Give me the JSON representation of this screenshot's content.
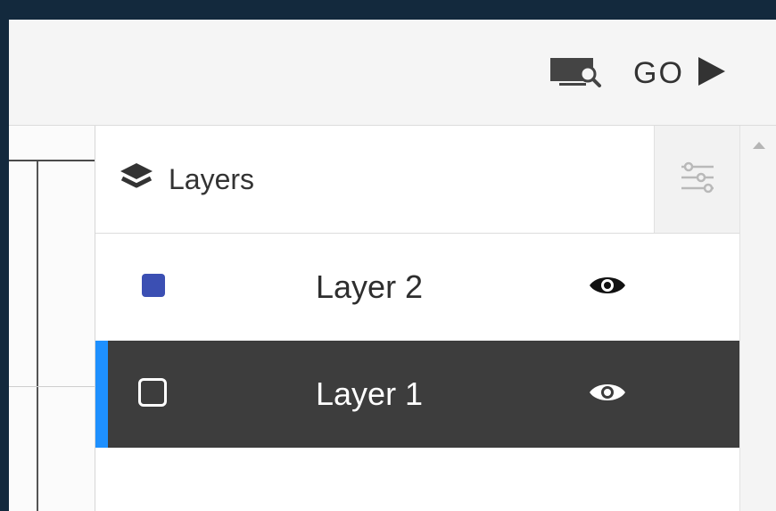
{
  "toolbar": {
    "preview_icon": "screen-search-icon",
    "go_label": "GO",
    "go_icon": "play-icon"
  },
  "layers_panel": {
    "title": "Layers",
    "title_icon": "layers-icon",
    "settings_icon": "sliders-icon",
    "layers": [
      {
        "name": "Layer 2",
        "color": "#3b4fb3",
        "visible": true,
        "selected": false
      },
      {
        "name": "Layer 1",
        "color": "#3d3d3d",
        "visible": true,
        "selected": true
      }
    ]
  },
  "colors": {
    "selection_accent": "#1e90ff",
    "selected_row": "#3d3d3d",
    "frame": "#13293d"
  }
}
